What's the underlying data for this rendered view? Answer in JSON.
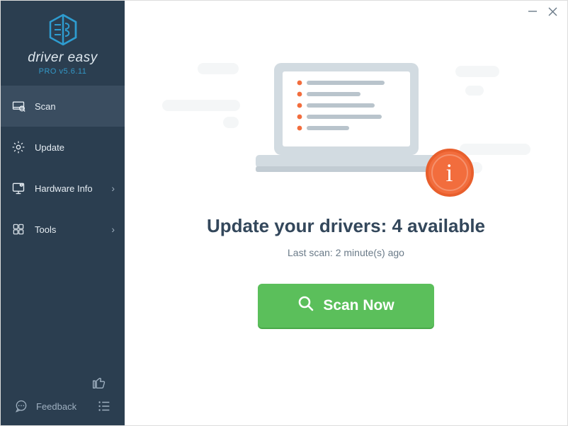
{
  "app": {
    "brand_top": "driver easy",
    "brand_sub": "PRO v5.6.11"
  },
  "sidebar": {
    "items": [
      {
        "label": "Scan",
        "has_chevron": false,
        "active": true
      },
      {
        "label": "Update",
        "has_chevron": false,
        "active": false
      },
      {
        "label": "Hardware Info",
        "has_chevron": true,
        "active": false
      },
      {
        "label": "Tools",
        "has_chevron": true,
        "active": false
      }
    ],
    "feedback_label": "Feedback"
  },
  "main": {
    "headline": "Update your drivers: 4 available",
    "subline": "Last scan: 2 minute(s) ago",
    "scan_button": "Scan Now"
  }
}
